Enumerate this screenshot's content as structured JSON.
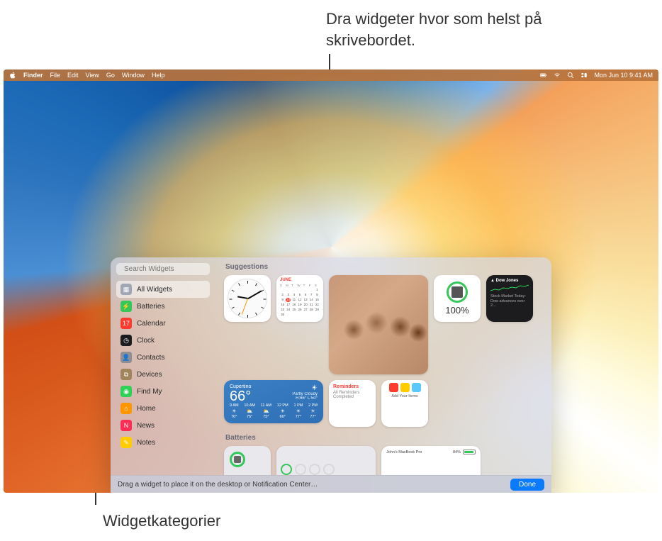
{
  "callouts": {
    "top": "Dra widgeter hvor som helst på skrivebordet.",
    "bottom": "Widgetkategorier"
  },
  "menubar": {
    "app": "Finder",
    "items": [
      "File",
      "Edit",
      "View",
      "Go",
      "Window",
      "Help"
    ],
    "datetime": "Mon Jun 10  9:41 AM"
  },
  "panel": {
    "search_placeholder": "Search Widgets",
    "footer_hint": "Drag a widget to place it on the desktop or Notification Center…",
    "done": "Done",
    "sections": {
      "suggestions": "Suggestions",
      "batteries": "Batteries"
    }
  },
  "categories": [
    {
      "label": "All Widgets",
      "color": "#a0a6b4",
      "icon": "grid"
    },
    {
      "label": "Batteries",
      "color": "#34c759",
      "icon": "bolt"
    },
    {
      "label": "Calendar",
      "color": "#ff3b30",
      "icon": "cal"
    },
    {
      "label": "Clock",
      "color": "#1c1c1e",
      "icon": "clock"
    },
    {
      "label": "Contacts",
      "color": "#8e8e93",
      "icon": "person"
    },
    {
      "label": "Devices",
      "color": "#a0845c",
      "icon": "devices"
    },
    {
      "label": "Find My",
      "color": "#30d158",
      "icon": "findmy"
    },
    {
      "label": "Home",
      "color": "#ff9500",
      "icon": "home"
    },
    {
      "label": "News",
      "color": "#ff2d55",
      "icon": "news"
    },
    {
      "label": "Notes",
      "color": "#ffcc00",
      "icon": "notes"
    }
  ],
  "calendar": {
    "month": "JUNE",
    "dow": [
      "S",
      "M",
      "T",
      "W",
      "T",
      "F",
      "S"
    ],
    "today": 10
  },
  "weather": {
    "location": "Cupertino",
    "temp": "66°",
    "condition": "Partly Cloudy",
    "hilo": "H:66° L:50°",
    "hours": [
      {
        "t": "9 AM",
        "i": "☀",
        "d": "70°"
      },
      {
        "t": "10 AM",
        "i": "⛅",
        "d": "75°"
      },
      {
        "t": "11 AM",
        "i": "⛅",
        "d": "75°"
      },
      {
        "t": "12 PM",
        "i": "☀",
        "d": "66°"
      },
      {
        "t": "1 PM",
        "i": "☀",
        "d": "77°"
      },
      {
        "t": "2 PM",
        "i": "☀",
        "d": "77°"
      }
    ]
  },
  "battery": {
    "pct": "100%"
  },
  "stocks": {
    "symbol": "▲ Dow Jones",
    "headline": "Stock Market Today: Dow advances over 2…"
  },
  "reminders": {
    "title": "Reminders",
    "subtitle": "All Reminders Completed"
  },
  "findmy": {
    "label": "Add Your Items"
  },
  "battery_list": {
    "device": "John's MacBook Pro",
    "pct": "84%"
  }
}
